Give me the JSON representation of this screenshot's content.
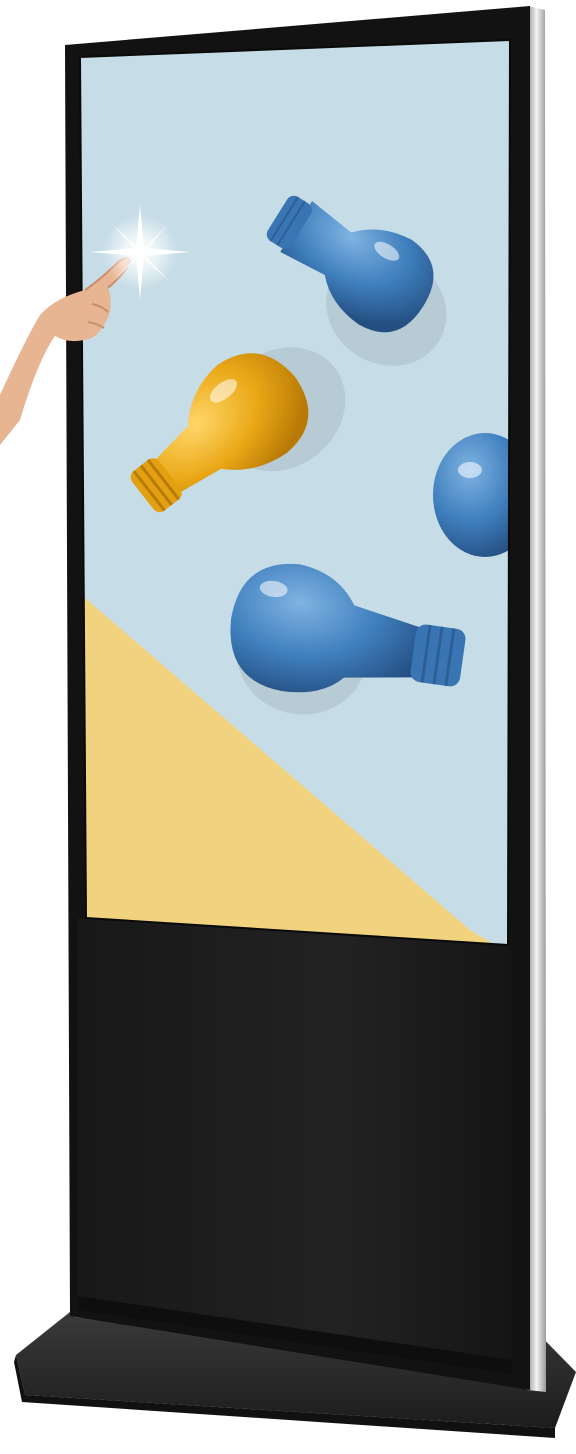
{
  "scene": {
    "subject": "floor-standing-touchscreen-kiosk",
    "colors": {
      "background": "#ffffff",
      "bezel": "#121212",
      "silver_trim": "#c9c9c9",
      "lower_panel": "#1d1d1d",
      "base": "#2a2a2a",
      "screen_blue": "#c6dde7",
      "screen_yellow": "#f1d27e",
      "bulb_blue": "#3f7fbd",
      "bulb_yellow": "#eaa817",
      "skin": "#e8b592"
    },
    "icons": {
      "touch": "sparkle-icon"
    }
  }
}
